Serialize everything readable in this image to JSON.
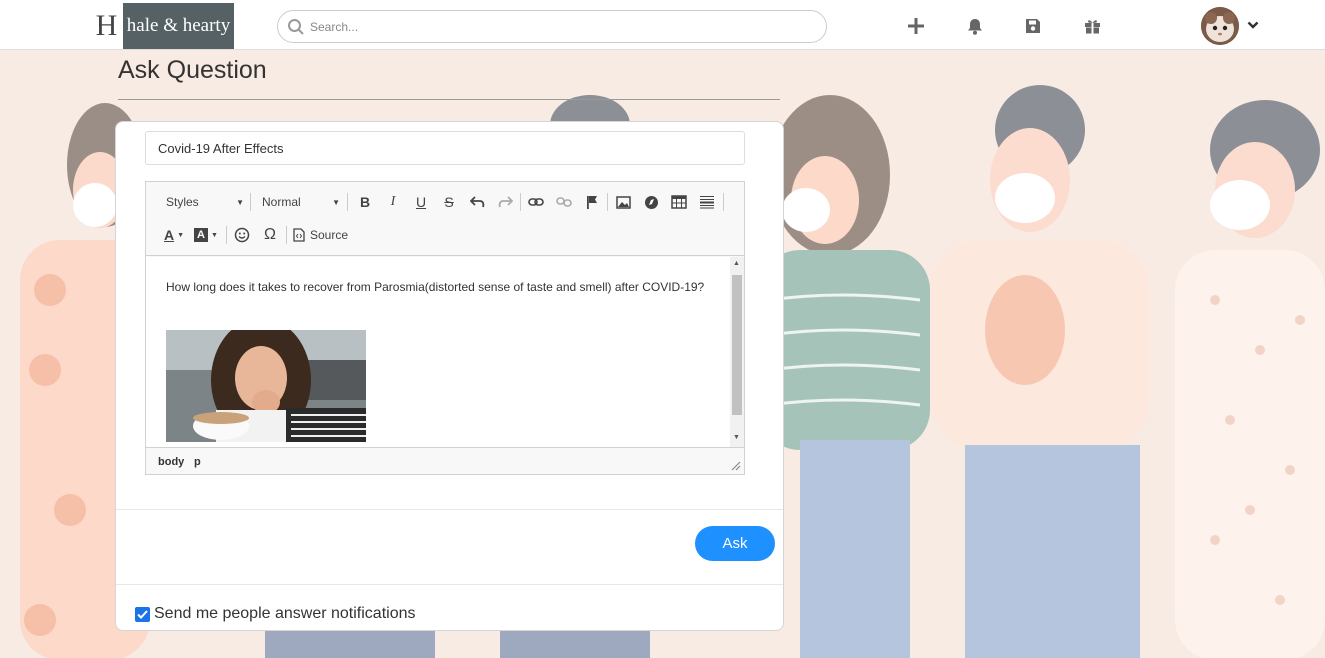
{
  "header": {
    "logo_mark": "H",
    "logo_text": "hale & hearty",
    "search_placeholder": "Search...",
    "icons": [
      "plus-icon",
      "bell-icon",
      "save-icon",
      "gift-icon"
    ],
    "avatar": "user-avatar"
  },
  "page": {
    "title": "Ask Question"
  },
  "form": {
    "question_title": "Covid-19 After Effects",
    "toolbar": {
      "styles_label": "Styles",
      "format_label": "Normal",
      "source_label": "Source"
    },
    "body_text": "How long does it takes to recover from Parosmia(distorted sense of taste and smell) after COVID-19?",
    "status_path": [
      "body",
      "p"
    ],
    "ask_label": "Ask",
    "notify_label": "Send me people answer notifications",
    "notify_checked": true
  },
  "colors": {
    "accent": "#1e90ff",
    "logo_bg": "#566166",
    "background": "#f7ebe4"
  }
}
